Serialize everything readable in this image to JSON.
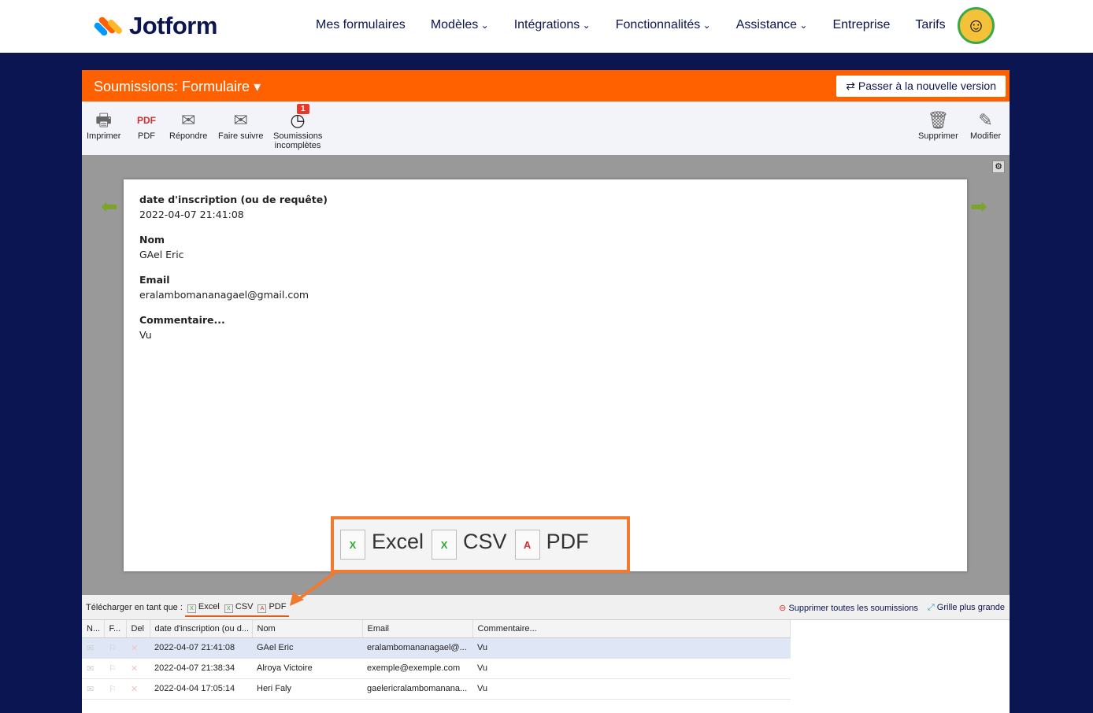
{
  "header": {
    "logo": "Jotform",
    "nav": [
      {
        "label": "Mes formulaires",
        "dropdown": false
      },
      {
        "label": "Modèles",
        "dropdown": true
      },
      {
        "label": "Intégrations",
        "dropdown": true
      },
      {
        "label": "Fonctionnalités",
        "dropdown": true
      },
      {
        "label": "Assistance",
        "dropdown": true
      },
      {
        "label": "Entreprise",
        "dropdown": false
      },
      {
        "label": "Tarifs",
        "dropdown": false
      }
    ]
  },
  "panel": {
    "title": "Soumissions: Formulaire",
    "switch_label": "Passer à la nouvelle version"
  },
  "toolbar": {
    "print": "Imprimer",
    "pdf": "PDF",
    "reply": "Répondre",
    "forward": "Faire suivre",
    "incomplete": "Soumissions incomplètes",
    "incomplete_count": "1",
    "delete": "Supprimer",
    "edit": "Modifier"
  },
  "submission": [
    {
      "label": "date d'inscription (ou de requête)",
      "value": "2022-04-07 21:41:08"
    },
    {
      "label": "Nom",
      "value": "GAel Eric"
    },
    {
      "label": "Email",
      "value": "eralambomananagael@gmail.com"
    },
    {
      "label": "Commentaire...",
      "value": "Vu"
    }
  ],
  "callout": {
    "excel": "Excel",
    "csv": "CSV",
    "pdf": "PDF"
  },
  "download": {
    "label": "Télécharger en tant que :",
    "excel": "Excel",
    "csv": "CSV",
    "pdf": "PDF",
    "delete_all": "Supprimer toutes les soumissions",
    "bigger_grid": "Grille plus grande"
  },
  "table": {
    "headers": [
      "N...",
      "F...",
      "Del",
      "date d'inscription (ou d...",
      "Nom",
      "Email",
      "Commentaire..."
    ],
    "rows": [
      {
        "date": "2022-04-07 21:41:08",
        "name": "GAel Eric",
        "email": "eralambomananagael@...",
        "comment": "Vu"
      },
      {
        "date": "2022-04-07 21:38:34",
        "name": "Alroya Victoire",
        "email": "exemple@exemple.com",
        "comment": "Vu"
      },
      {
        "date": "2022-04-04 17:05:14",
        "name": "Heri Faly",
        "email": "gaelericralambomanana...",
        "comment": "Vu"
      }
    ]
  }
}
